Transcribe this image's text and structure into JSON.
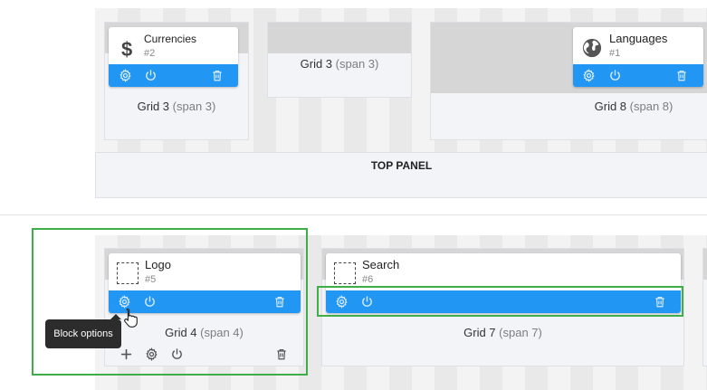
{
  "top_section": {
    "panel_label": "TOP PANEL",
    "grids": [
      {
        "label": "Grid 3",
        "span": "(span 3)",
        "block": {
          "title": "Currencies",
          "id": "#2",
          "icon": "dollar-icon"
        }
      },
      {
        "label": "Grid 3",
        "span": "(span 3)"
      },
      {
        "label": "Grid 8",
        "span": "(span 8)",
        "block": {
          "title": "Languages",
          "id": "#1",
          "icon": "globe-icon"
        }
      }
    ]
  },
  "bottom_section": {
    "grids": [
      {
        "label": "Grid 4",
        "span": "(span 4)",
        "block": {
          "title": "Logo",
          "id": "#5",
          "icon": "placeholder-icon"
        }
      },
      {
        "label": "Grid 7",
        "span": "(span 7)",
        "block": {
          "title": "Search",
          "id": "#6",
          "icon": "placeholder-icon"
        }
      }
    ]
  },
  "tooltip": {
    "text": "Block options"
  },
  "colors": {
    "accent": "#2196f3",
    "highlight": "#3fae49",
    "tooltip_bg": "#2c2c2c"
  }
}
